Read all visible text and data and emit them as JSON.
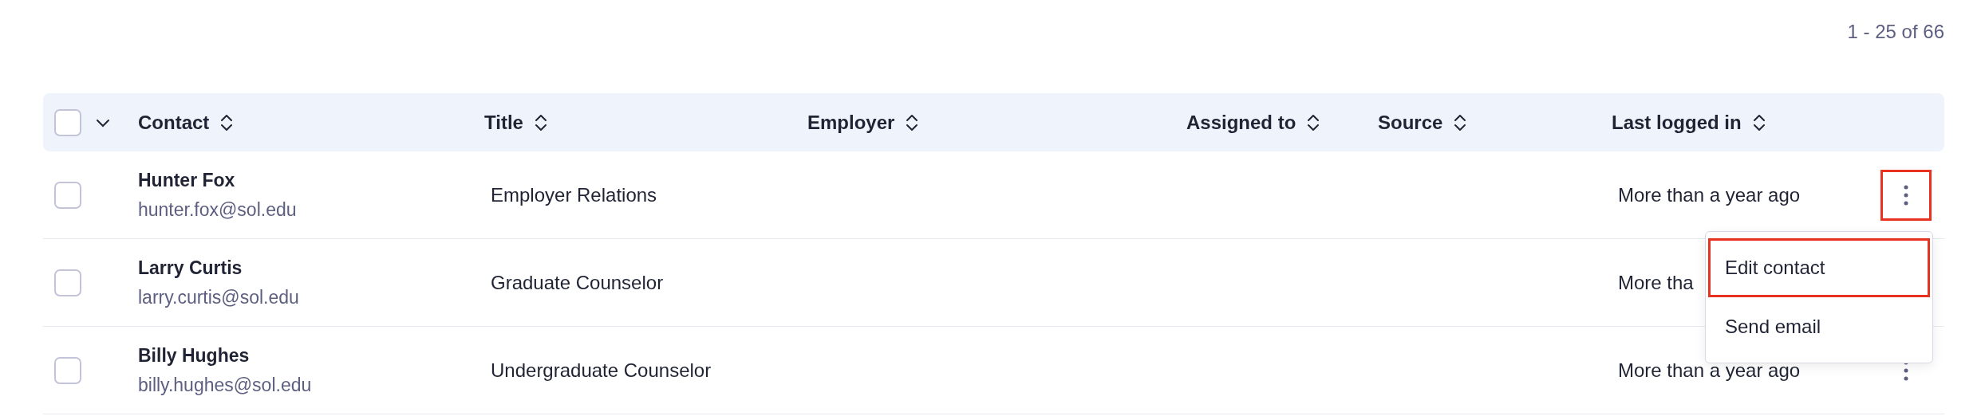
{
  "pagination": "1 - 25 of 66",
  "header": {
    "select_all": {
      "checked": false
    },
    "columns": [
      {
        "label": "Contact"
      },
      {
        "label": "Title"
      },
      {
        "label": "Employer"
      },
      {
        "label": "Assigned to"
      },
      {
        "label": "Source"
      },
      {
        "label": "Last logged in"
      }
    ]
  },
  "rows": [
    {
      "checked": false,
      "name": "Hunter Fox",
      "email": "hunter.fox@sol.edu",
      "title": "Employer Relations",
      "last_logged_in": "More than a year ago",
      "more_button": {
        "highlighted": true
      }
    },
    {
      "checked": false,
      "name": "Larry Curtis",
      "email": "larry.curtis@sol.edu",
      "title": "Graduate Counselor",
      "last_logged_in": "More tha"
    },
    {
      "checked": false,
      "name": "Billy Hughes",
      "email": "billy.hughes@sol.edu",
      "title": "Undergraduate Counselor",
      "last_logged_in": "More than a year ago",
      "more_button": {
        "highlighted": false
      }
    }
  ],
  "menu": {
    "items": [
      {
        "label": "Edit contact",
        "highlighted": true
      },
      {
        "label": "Send email",
        "highlighted": false
      }
    ]
  }
}
